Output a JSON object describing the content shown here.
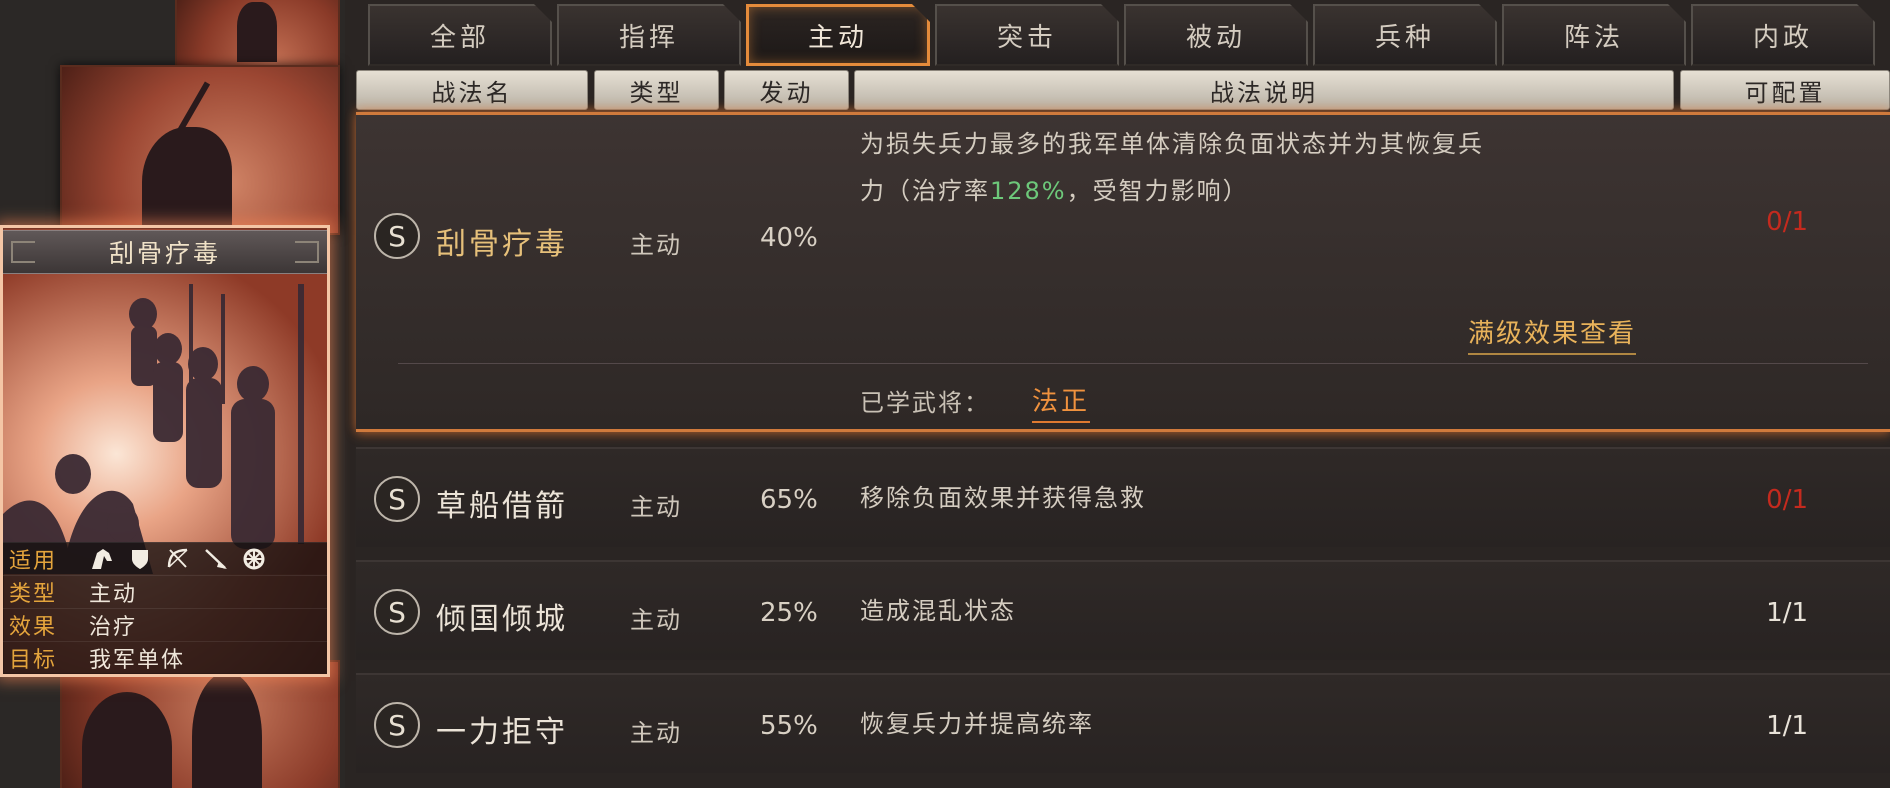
{
  "card": {
    "title": "刮骨疗毒",
    "info": [
      {
        "key": "适用",
        "value": ""
      },
      {
        "key": "类型",
        "value": "主动"
      },
      {
        "key": "效果",
        "value": "治疗"
      },
      {
        "key": "目标",
        "value": "我军单体"
      }
    ],
    "troop_icons": [
      "cavalry-icon",
      "shield-icon",
      "bow-icon",
      "spear-icon",
      "siege-wheel-icon"
    ]
  },
  "tabs": [
    "全部",
    "指挥",
    "主动",
    "突击",
    "被动",
    "兵种",
    "阵法",
    "内政"
  ],
  "active_tab": "主动",
  "headers": {
    "name": "战法名",
    "type": "类型",
    "trigger": "发动",
    "desc": "战法说明",
    "config": "可配置"
  },
  "rows": [
    {
      "badge": "S",
      "name": "刮骨疗毒",
      "type": "主动",
      "rate": "40%",
      "desc_line1": "为损失兵力最多的我军单体清除负面状态并为其恢复兵",
      "desc_line2_pre": "力（治疗率",
      "desc_line2_highlight": "128%",
      "desc_line2_post": "，受智力影响）",
      "config": "0/1",
      "max_effect_link": "满级效果查看",
      "learned_label": "已学武将：",
      "learned_general": "法正"
    },
    {
      "badge": "S",
      "name": "草船借箭",
      "type": "主动",
      "rate": "65%",
      "desc": "移除负面效果并获得急救",
      "config": "0/1"
    },
    {
      "badge": "S",
      "name": "倾国倾城",
      "type": "主动",
      "rate": "25%",
      "desc": "造成混乱状态",
      "config": "1/1"
    },
    {
      "badge": "S",
      "name": "一力拒守",
      "type": "主动",
      "rate": "55%",
      "desc": "恢复兵力并提高统率",
      "config": "1/1"
    }
  ],
  "colors": {
    "accent_orange": "#e48b3b",
    "config_red": "#c42a1e",
    "highlight_green": "#6dc87a",
    "link_gold": "#e8b25a"
  }
}
